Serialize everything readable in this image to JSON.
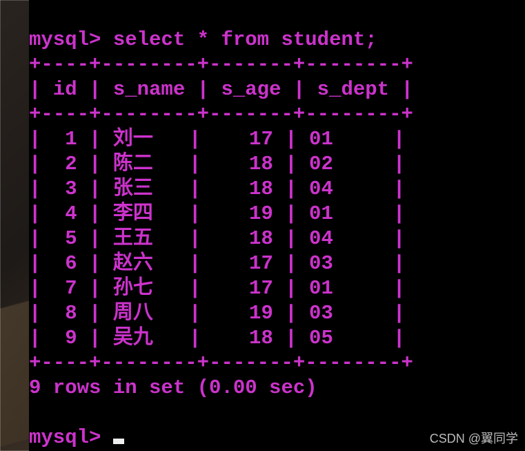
{
  "prompt1": "mysql> ",
  "command": "select * from student;",
  "border_top": "+----+--------+-------+--------+",
  "header_row": "| id | s_name | s_age | s_dept |",
  "border_mid": "+----+--------+-------+--------+",
  "rows": [
    "|  1 | 刘一   |    17 | 01     |",
    "|  2 | 陈二   |    18 | 02     |",
    "|  3 | 张三   |    18 | 04     |",
    "|  4 | 李四   |    19 | 01     |",
    "|  5 | 王五   |    18 | 04     |",
    "|  6 | 赵六   |    17 | 03     |",
    "|  7 | 孙七   |    17 | 01     |",
    "|  8 | 周八   |    19 | 03     |",
    "|  9 | 吴九   |    18 | 05     |"
  ],
  "border_bot": "+----+--------+-------+--------+",
  "summary": "9 rows in set (0.00 sec)",
  "prompt2": "mysql> ",
  "watermark": "CSDN @翼同学",
  "chart_data": {
    "type": "table",
    "title": "student",
    "columns": [
      "id",
      "s_name",
      "s_age",
      "s_dept"
    ],
    "data": [
      {
        "id": 1,
        "s_name": "刘一",
        "s_age": 17,
        "s_dept": "01"
      },
      {
        "id": 2,
        "s_name": "陈二",
        "s_age": 18,
        "s_dept": "02"
      },
      {
        "id": 3,
        "s_name": "张三",
        "s_age": 18,
        "s_dept": "04"
      },
      {
        "id": 4,
        "s_name": "李四",
        "s_age": 19,
        "s_dept": "01"
      },
      {
        "id": 5,
        "s_name": "王五",
        "s_age": 18,
        "s_dept": "04"
      },
      {
        "id": 6,
        "s_name": "赵六",
        "s_age": 17,
        "s_dept": "03"
      },
      {
        "id": 7,
        "s_name": "孙七",
        "s_age": 17,
        "s_dept": "01"
      },
      {
        "id": 8,
        "s_name": "周八",
        "s_age": 19,
        "s_dept": "03"
      },
      {
        "id": 9,
        "s_name": "吴九",
        "s_age": 18,
        "s_dept": "05"
      }
    ]
  }
}
